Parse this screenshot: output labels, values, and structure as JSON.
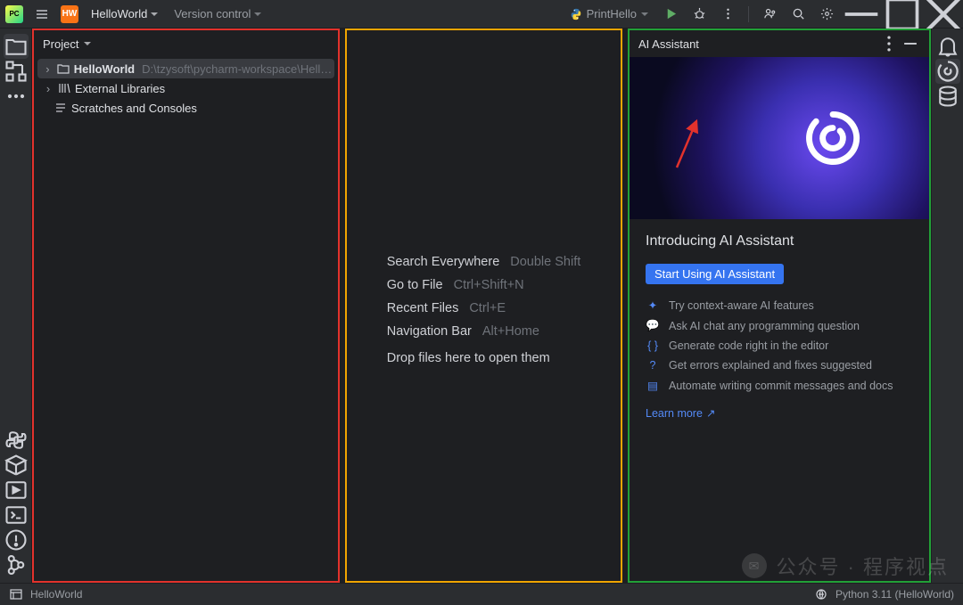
{
  "titlebar": {
    "hw_badge": "HW",
    "project_name": "HelloWorld",
    "vcs_label": "Version control",
    "run_target": "PrintHello"
  },
  "project_panel": {
    "title": "Project",
    "tree": {
      "root_name": "HelloWorld",
      "root_path": "D:\\tzysoft\\pycharm-workspace\\HelloWorld",
      "ext_lib": "External Libraries",
      "scratch": "Scratches and Consoles"
    }
  },
  "welcome": {
    "search_label": "Search Everywhere",
    "search_sc": "Double Shift",
    "goto_label": "Go to File",
    "goto_sc": "Ctrl+Shift+N",
    "recent_label": "Recent Files",
    "recent_sc": "Ctrl+E",
    "nav_label": "Navigation Bar",
    "nav_sc": "Alt+Home",
    "drop": "Drop files here to open them"
  },
  "ai": {
    "title": "AI Assistant",
    "heading": "Introducing AI Assistant",
    "cta": "Start Using AI Assistant",
    "features": [
      "Try context-aware AI features",
      "Ask AI chat any programming question",
      "Generate code right in the editor",
      "Get errors explained and fixes suggested",
      "Automate writing commit messages and docs"
    ],
    "learn_more": "Learn more"
  },
  "status": {
    "project": "HelloWorld",
    "interpreter": "Python 3.11 (HelloWorld)"
  },
  "watermark": "公众号 · 程序视点"
}
